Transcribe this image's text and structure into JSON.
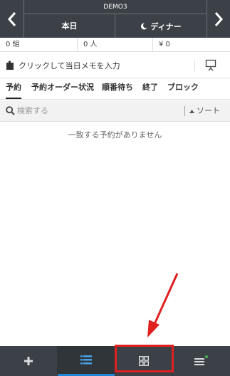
{
  "header": {
    "shop_name": "DEMO3",
    "date_label": "本日",
    "meal_label": "ディナー",
    "prev_icon": "chevron-left-icon",
    "next_icon": "chevron-right-icon",
    "meal_icon": "moon-icon"
  },
  "stats": {
    "groups": "0 組",
    "people": "0 人",
    "amount": "¥ 0"
  },
  "memo": {
    "placeholder": "クリックして当日メモを入力",
    "left_icon": "memo-clip-icon",
    "right_icon": "presentation-icon"
  },
  "tabs": [
    {
      "label": "予約",
      "active": true
    },
    {
      "label": "予約オーダー状況",
      "active": false
    },
    {
      "label": "順番待ち",
      "active": false
    },
    {
      "label": "終了",
      "active": false
    },
    {
      "label": "ブロック",
      "active": false
    }
  ],
  "search": {
    "placeholder": "検索する",
    "sort_label": "ソート"
  },
  "empty_message": "一致する予約がありません",
  "bottom_bar": {
    "items": [
      {
        "icon": "plus-icon",
        "active": false
      },
      {
        "icon": "list-icon",
        "active": true
      },
      {
        "icon": "grid-icon",
        "active": false
      },
      {
        "icon": "menu-icon",
        "active": false
      }
    ]
  },
  "colors": {
    "header_bg": "#3c4147",
    "accent_blue": "#1e87d6",
    "annotation_red": "#e02020",
    "notify_dot": "#4caf50"
  }
}
